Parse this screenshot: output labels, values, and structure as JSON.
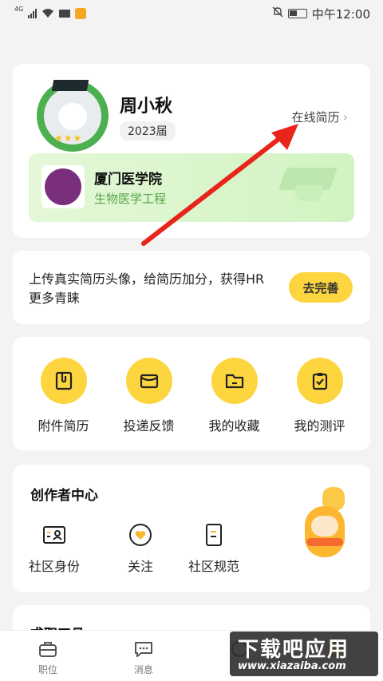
{
  "status_bar": {
    "network": "4G",
    "time": "中午12:00"
  },
  "profile": {
    "name": "周小秋",
    "grad_year": "2023届",
    "online_resume": "在线简历",
    "school": "厦门医学院",
    "major": "生物医学工程"
  },
  "tip": {
    "text": "上传真实简历头像，给简历加分，获得HR更多青睐",
    "button": "去完善"
  },
  "shortcuts": [
    {
      "label": "附件简历",
      "icon": "attachment-resume-icon"
    },
    {
      "label": "投递反馈",
      "icon": "delivery-feedback-icon"
    },
    {
      "label": "我的收藏",
      "icon": "folder-icon"
    },
    {
      "label": "我的测评",
      "icon": "clipboard-check-icon"
    }
  ],
  "creator_center": {
    "title": "创作者中心",
    "items": [
      {
        "label": "社区身份",
        "icon": "id-card-icon"
      },
      {
        "label": "关注",
        "icon": "heart-icon"
      },
      {
        "label": "社区规范",
        "icon": "document-icon"
      }
    ]
  },
  "partial_section": {
    "title": "求职工具"
  },
  "tabbar": [
    {
      "label": "职位",
      "icon": "briefcase-icon"
    },
    {
      "label": "消息",
      "icon": "chat-icon"
    },
    {
      "label": "",
      "icon": "discover-icon"
    },
    {
      "label": "",
      "icon": "profile-icon"
    }
  ],
  "watermark": {
    "title": "下载吧应用",
    "url": "www.xiazaiba.com"
  },
  "colors": {
    "accent": "#fdd53f",
    "arrow": "#e8251b",
    "school_panel": "#dff6d2",
    "major_text": "#58a44a"
  }
}
